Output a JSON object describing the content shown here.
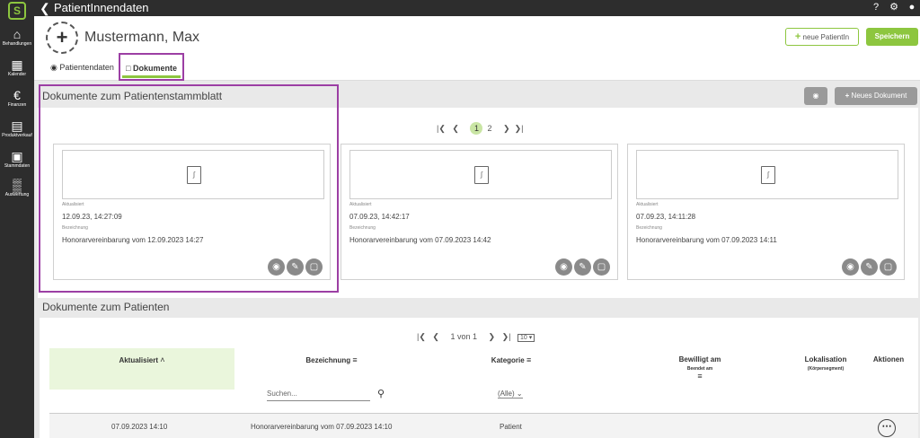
{
  "sidebar": {
    "logo": "S",
    "items": [
      {
        "label": "Behandlungen",
        "icon": "home-icon"
      },
      {
        "label": "Kalender",
        "icon": "calendar-icon"
      },
      {
        "label": "Finanzen",
        "icon": "euro-icon"
      },
      {
        "label": "Produktverkauf",
        "icon": "document-icon"
      },
      {
        "label": "Stammdaten",
        "icon": "puzzle-icon"
      },
      {
        "label": "Auswertung",
        "icon": "bar-chart-icon"
      }
    ]
  },
  "topbar": {
    "title": "PatientInnendaten",
    "icons": [
      "help-icon",
      "gear-icon",
      "user-icon"
    ]
  },
  "patient": {
    "name": "Mustermann, Max"
  },
  "header_buttons": {
    "new_patient": "neue PatientIn",
    "save": "Speichern"
  },
  "tabs": [
    {
      "label": "Patientendaten",
      "icon": "user-circle-icon"
    },
    {
      "label": "Dokumente",
      "icon": "file-icon",
      "active": true
    }
  ],
  "stammblatt": {
    "title": "Dokumente zum Patientenstammblatt",
    "new_document": "Neues Dokument",
    "pager": {
      "pages": [
        "1",
        "2"
      ],
      "current": "1"
    },
    "cards": [
      {
        "updated_label": "Aktualisiert",
        "updated": "12.09.23, 14:27:09",
        "name_label": "Bezeichnung",
        "name": "Honorarvereinbarung vom 12.09.2023 14:27"
      },
      {
        "updated_label": "Aktualisiert",
        "updated": "07.09.23, 14:42:17",
        "name_label": "Bezeichnung",
        "name": "Honorarvereinbarung vom 07.09.2023 14:42"
      },
      {
        "updated_label": "Aktualisiert",
        "updated": "07.09.23, 14:11:28",
        "name_label": "Bezeichnung",
        "name": "Honorarvereinbarung vom 07.09.2023 14:11"
      }
    ]
  },
  "patient_docs": {
    "title": "Dokumente zum Patienten",
    "pager": {
      "text": "1 von 1",
      "page_size": "10"
    },
    "columns": {
      "updated": "Aktualisiert",
      "name": "Bezeichnung",
      "category": "Kategorie",
      "approved": "Bewilligt am",
      "ended": "Beendet am",
      "location": "Lokalisation",
      "location_sub": "(Körpersegment)",
      "actions": "Aktionen"
    },
    "search_placeholder": "Suchen...",
    "category_filter": "(Alle)",
    "rows": [
      {
        "updated": "07.09.2023 14:10",
        "name": "Honorarvereinbarung vom 07.09.2023 14:10",
        "category": "Patient"
      }
    ]
  },
  "colors": {
    "accent": "#8dc63f",
    "highlight": "#9c3fa4",
    "dark": "#2d2d2d"
  }
}
